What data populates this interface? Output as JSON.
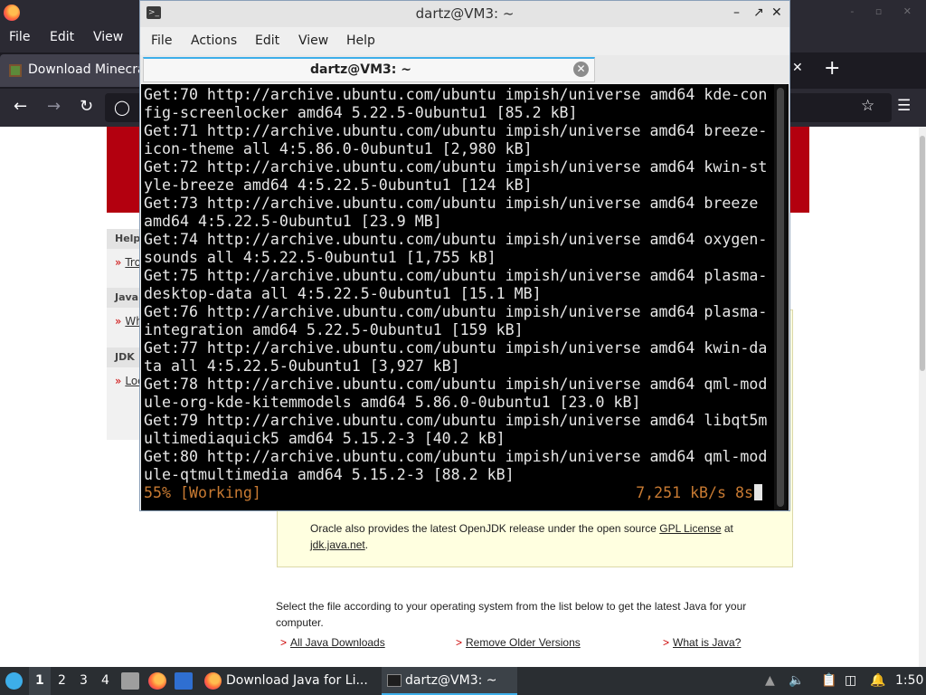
{
  "firefox": {
    "menu": [
      "File",
      "Edit",
      "View"
    ],
    "tab_title": "Download Minecra",
    "close_glyph": "✕",
    "new_tab_glyph": "+",
    "window_buttons": "- ▫ ✕"
  },
  "page": {
    "sidebar": {
      "sections": [
        {
          "heading": "Help",
          "link": "Tro"
        },
        {
          "heading": "Java",
          "link": "Wh"
        },
        {
          "heading": "JDK",
          "link": "Loo"
        }
      ]
    },
    "note": {
      "line_part1": "Oracle also provides the latest OpenJDK release under the open source ",
      "gpl_link": "GPL License",
      "line_part2": " at",
      "jdk_link": "jdk.java.net",
      "period": "."
    },
    "select_text": "Select the file according to your operating system from the list below to get the latest Java for your computer.",
    "links": {
      "all_downloads": "All Java Downloads",
      "remove_older": "Remove Older Versions",
      "what_is_java": "What is Java?"
    },
    "link_arrow": ">"
  },
  "terminal": {
    "title": "dartz@VM3: ~",
    "menu": [
      "File",
      "Actions",
      "Edit",
      "View",
      "Help"
    ],
    "tab_label": "dartz@VM3: ~",
    "lines": [
      "Get:70 http://archive.ubuntu.com/ubuntu impish/universe amd64 kde-con",
      "fig-screenlocker amd64 5.22.5-0ubuntu1 [85.2 kB]",
      "Get:71 http://archive.ubuntu.com/ubuntu impish/universe amd64 breeze-",
      "icon-theme all 4:5.86.0-0ubuntu1 [2,980 kB]",
      "Get:72 http://archive.ubuntu.com/ubuntu impish/universe amd64 kwin-st",
      "yle-breeze amd64 4:5.22.5-0ubuntu1 [124 kB]",
      "Get:73 http://archive.ubuntu.com/ubuntu impish/universe amd64 breeze",
      "amd64 4:5.22.5-0ubuntu1 [23.9 MB]",
      "Get:74 http://archive.ubuntu.com/ubuntu impish/universe amd64 oxygen-",
      "sounds all 4:5.22.5-0ubuntu1 [1,755 kB]",
      "Get:75 http://archive.ubuntu.com/ubuntu impish/universe amd64 plasma-",
      "desktop-data all 4:5.22.5-0ubuntu1 [15.1 MB]",
      "Get:76 http://archive.ubuntu.com/ubuntu impish/universe amd64 plasma-",
      "integration amd64 5.22.5-0ubuntu1 [159 kB]",
      "Get:77 http://archive.ubuntu.com/ubuntu impish/universe amd64 kwin-da",
      "ta all 4:5.22.5-0ubuntu1 [3,927 kB]",
      "Get:78 http://archive.ubuntu.com/ubuntu impish/universe amd64 qml-mod",
      "ule-org-kde-kitemmodels amd64 5.86.0-0ubuntu1 [23.0 kB]",
      "Get:79 http://archive.ubuntu.com/ubuntu impish/universe amd64 libqt5m",
      "ultimediaquick5 amd64 5.15.2-3 [40.2 kB]",
      "Get:80 http://archive.ubuntu.com/ubuntu impish/universe amd64 qml-mod",
      "ule-qtmultimedia amd64 5.15.2-3 [88.2 kB]"
    ],
    "status_left": "55% [Working]",
    "status_right": "7,251 kB/s 8s",
    "progress_percent": 55
  },
  "taskbar": {
    "workspaces": [
      "1",
      "2",
      "3",
      "4"
    ],
    "active_workspace": "1",
    "tasks": [
      {
        "label": "Download Java for Li..."
      },
      {
        "label": "dartz@VM3: ~"
      }
    ],
    "clock": "1:50"
  },
  "colors": {
    "accent": "#3daee9",
    "terminal_status": "#c87a32",
    "oracle_red": "#b3000f",
    "note_bg": "#ffffe0"
  },
  "icons": [
    "firefox-icon",
    "minecraft-tab-icon",
    "back-icon",
    "forward-icon",
    "reload-icon",
    "shield-icon",
    "star-icon",
    "menu-icon",
    "terminal-icon",
    "close-tab-icon",
    "start-menu-icon",
    "file-manager-icon",
    "volume-icon",
    "clipboard-icon",
    "network-icon",
    "notifications-icon"
  ]
}
